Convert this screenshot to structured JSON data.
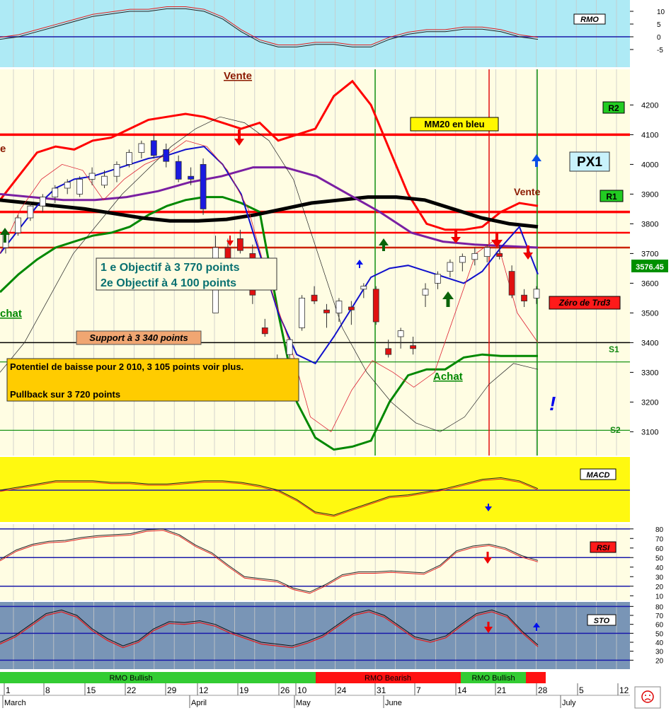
{
  "chart_data": [
    {
      "type": "line",
      "panel": "rmo",
      "label": "RMO",
      "ylim": [
        -8,
        13
      ],
      "yticks": [
        -5,
        0,
        5,
        10
      ],
      "reference_line": 0,
      "series": [
        {
          "values": [
            -1,
            0,
            2,
            4,
            6,
            8,
            9,
            10,
            10,
            11,
            11,
            10,
            7,
            2,
            -2,
            -4,
            -4,
            -3,
            -3,
            -4,
            -4,
            -1,
            1,
            2,
            2,
            3,
            3,
            2,
            0,
            -1
          ]
        }
      ]
    },
    {
      "type": "candlestick",
      "panel": "price",
      "ylim": [
        3020,
        4320
      ],
      "yticks": [
        3100,
        3200,
        3300,
        3400,
        3500,
        3600,
        3700,
        3800,
        3900,
        4000,
        4100,
        4200
      ],
      "last_price": "3576.45",
      "levels": [
        {
          "label": "R2",
          "value": 4100,
          "color": "#ff0000"
        },
        {
          "label": "R1",
          "value": 3840,
          "color": "#ff0000"
        },
        {
          "label": "",
          "value": 3770,
          "color": "#ff0000"
        },
        {
          "label": "",
          "value": 3720,
          "color": "#cc2200"
        },
        {
          "label": "",
          "value": 3400,
          "color": "#000000"
        },
        {
          "label": "S1",
          "value": 3335,
          "color": "#008800"
        },
        {
          "label": "S2",
          "value": 3105,
          "color": "#008800"
        }
      ],
      "candles": [
        [
          3720,
          3780,
          3700,
          3770
        ],
        [
          3770,
          3830,
          3760,
          3820
        ],
        [
          3820,
          3870,
          3810,
          3860
        ],
        [
          3860,
          3900,
          3840,
          3890
        ],
        [
          3890,
          3930,
          3870,
          3920
        ],
        [
          3920,
          3950,
          3900,
          3940
        ],
        [
          3900,
          3960,
          3890,
          3950
        ],
        [
          3950,
          3990,
          3930,
          3970
        ],
        [
          3930,
          3980,
          3920,
          3960
        ],
        [
          3960,
          4010,
          3940,
          4000
        ],
        [
          4000,
          4050,
          3990,
          4040
        ],
        [
          4040,
          4080,
          4020,
          4070
        ],
        [
          4080,
          4100,
          4020,
          4030
        ],
        [
          4050,
          4070,
          3990,
          4010
        ],
        [
          4010,
          4030,
          3940,
          3950
        ],
        [
          3960,
          3990,
          3930,
          3950
        ],
        [
          4000,
          4020,
          3830,
          3850
        ],
        [
          3500,
          3760,
          3500,
          3720
        ],
        [
          3720,
          3750,
          3610,
          3630
        ],
        [
          3750,
          3780,
          3700,
          3710
        ],
        [
          3700,
          3730,
          3530,
          3560
        ],
        [
          3450,
          3480,
          3420,
          3430
        ],
        [
          3320,
          3360,
          3300,
          3330
        ],
        [
          3360,
          3420,
          3340,
          3410
        ],
        [
          3450,
          3560,
          3440,
          3550
        ],
        [
          3560,
          3590,
          3530,
          3540
        ],
        [
          3510,
          3530,
          3450,
          3500
        ],
        [
          3500,
          3550,
          3470,
          3540
        ],
        [
          3520,
          3540,
          3460,
          3510
        ],
        [
          3580,
          3600,
          3550,
          3590
        ],
        [
          3580,
          3590,
          3460,
          3470
        ],
        [
          3380,
          3410,
          3350,
          3360
        ],
        [
          3420,
          3450,
          3380,
          3440
        ],
        [
          3390,
          3420,
          3360,
          3380
        ],
        [
          3560,
          3600,
          3520,
          3580
        ],
        [
          3600,
          3640,
          3580,
          3630
        ],
        [
          3640,
          3680,
          3620,
          3670
        ],
        [
          3670,
          3700,
          3640,
          3690
        ],
        [
          3680,
          3720,
          3660,
          3700
        ],
        [
          3690,
          3730,
          3670,
          3720
        ],
        [
          3700,
          3730,
          3680,
          3690
        ],
        [
          3640,
          3660,
          3550,
          3560
        ],
        [
          3560,
          3580,
          3520,
          3540
        ],
        [
          3550,
          3590,
          3530,
          3580
        ]
      ],
      "series": [
        {
          "color": "#ff0000",
          "values": [
            3880,
            3960,
            4040,
            4060,
            4050,
            4080,
            4090,
            4120,
            4150,
            4160,
            4170,
            4160,
            4140,
            4120,
            4140,
            4080,
            4100,
            4120,
            4230,
            4280,
            4200,
            4050,
            3900,
            3800,
            3780,
            3780,
            3790,
            3840,
            3870,
            3860
          ]
        },
        {
          "color": "#008800",
          "values": [
            3570,
            3630,
            3680,
            3720,
            3740,
            3760,
            3770,
            3790,
            3830,
            3860,
            3880,
            3890,
            3890,
            3870,
            3840,
            3500,
            3200,
            3080,
            3040,
            3050,
            3070,
            3200,
            3290,
            3310,
            3310,
            3350,
            3360,
            3355,
            3355,
            3355
          ]
        },
        {
          "color": "#000000",
          "values": [
            3880,
            3870,
            3860,
            3850,
            3835,
            3820,
            3810,
            3810,
            3815,
            3830,
            3850,
            3870,
            3880,
            3890,
            3890,
            3880,
            3850,
            3820,
            3800,
            3790
          ]
        },
        {
          "color": "#7a1fa2",
          "values": [
            3900,
            3890,
            3880,
            3880,
            3890,
            3910,
            3940,
            3960,
            3990,
            3990,
            3960,
            3900,
            3840,
            3770,
            3740,
            3730,
            3725,
            3720
          ]
        },
        {
          "color": "#1010cc",
          "values": [
            3700,
            3780,
            3860,
            3920,
            3950,
            3960,
            3980,
            4000,
            4020,
            4030,
            4050,
            4060,
            4000,
            3900,
            3700,
            3500,
            3360,
            3330,
            3420,
            3520,
            3620,
            3650,
            3660,
            3640,
            3620,
            3600,
            3640,
            3720,
            3790,
            3630
          ]
        }
      ],
      "annotations": [
        {
          "text": "Vente",
          "color": "#8b1a00"
        },
        {
          "text": "MM20 en bleu",
          "color": "#000000"
        },
        {
          "text": "PX1",
          "color": "#000000"
        },
        {
          "text": "Vente",
          "color": "#8b1a00"
        },
        {
          "text": "e",
          "color": "#8b1a00"
        },
        {
          "text": "chat",
          "color": "#008800"
        },
        {
          "text": "1 e Objectif  à 3 770  points",
          "color": "#006666"
        },
        {
          "text": "2e  Objectif  à 4 100  points",
          "color": "#006666"
        },
        {
          "text": "Zéro de Trd3",
          "color": "#000000"
        },
        {
          "text": "Support à 3 340 points",
          "color": "#000000"
        },
        {
          "text": "Potentiel de baisse pour 2 010, 3 105 points  voir plus.",
          "color": "#000000"
        },
        {
          "text": "Pullback sur 3 720 points",
          "color": "#000000"
        },
        {
          "text": "Achat",
          "color": "#008800"
        },
        {
          "text": "!",
          "color": "#0000ee"
        }
      ]
    },
    {
      "type": "line",
      "panel": "macd",
      "label": "MACD",
      "series": [
        {
          "values": [
            0,
            2,
            4,
            6,
            6,
            6,
            5,
            5,
            4,
            4,
            5,
            6,
            6,
            5,
            3,
            0,
            -6,
            -14,
            -16,
            -12,
            -8,
            -4,
            -3,
            -1,
            1,
            4,
            7,
            8,
            6,
            1
          ]
        }
      ]
    },
    {
      "type": "line",
      "panel": "rsi",
      "label": "RSI",
      "ylim": [
        5,
        85
      ],
      "yticks": [
        10,
        20,
        30,
        40,
        50,
        60,
        70,
        80
      ],
      "reference_lines": [
        80,
        50,
        20
      ],
      "series": [
        {
          "values": [
            48,
            58,
            64,
            67,
            68,
            71,
            73,
            74,
            75,
            79,
            80,
            74,
            63,
            55,
            42,
            30,
            28,
            26,
            18,
            14,
            22,
            32,
            35,
            35,
            36,
            35,
            34,
            42,
            57,
            62,
            64,
            60,
            52,
            47
          ]
        }
      ]
    },
    {
      "type": "line",
      "panel": "sto",
      "label": "STO",
      "ylim": [
        10,
        85
      ],
      "yticks": [
        20,
        30,
        40,
        50,
        60,
        70,
        80
      ],
      "reference_lines": [
        80,
        50,
        20
      ],
      "series": [
        {
          "values": [
            40,
            48,
            60,
            72,
            76,
            70,
            55,
            44,
            36,
            42,
            55,
            63,
            62,
            64,
            60,
            52,
            46,
            40,
            38,
            36,
            41,
            48,
            60,
            72,
            76,
            70,
            58,
            46,
            42,
            47,
            60,
            72,
            76,
            70,
            52,
            37
          ]
        }
      ]
    },
    {
      "type": "table",
      "panel": "timeline",
      "bands": [
        {
          "label": "RMO Bullish",
          "color": "#33cc33"
        },
        {
          "label": "RMO Bearish",
          "color": "#ff1111"
        },
        {
          "label": "RMO Bullish",
          "color": "#33cc33"
        },
        {
          "label": "",
          "color": "#ff1111"
        }
      ],
      "days": [
        "1",
        "8",
        "15",
        "22",
        "29",
        "12",
        "19",
        "26",
        "10",
        "24",
        "31",
        "7",
        "14",
        "21",
        "28",
        "5",
        "12"
      ],
      "months": [
        "March",
        "April",
        "May",
        "June",
        "July"
      ]
    }
  ]
}
